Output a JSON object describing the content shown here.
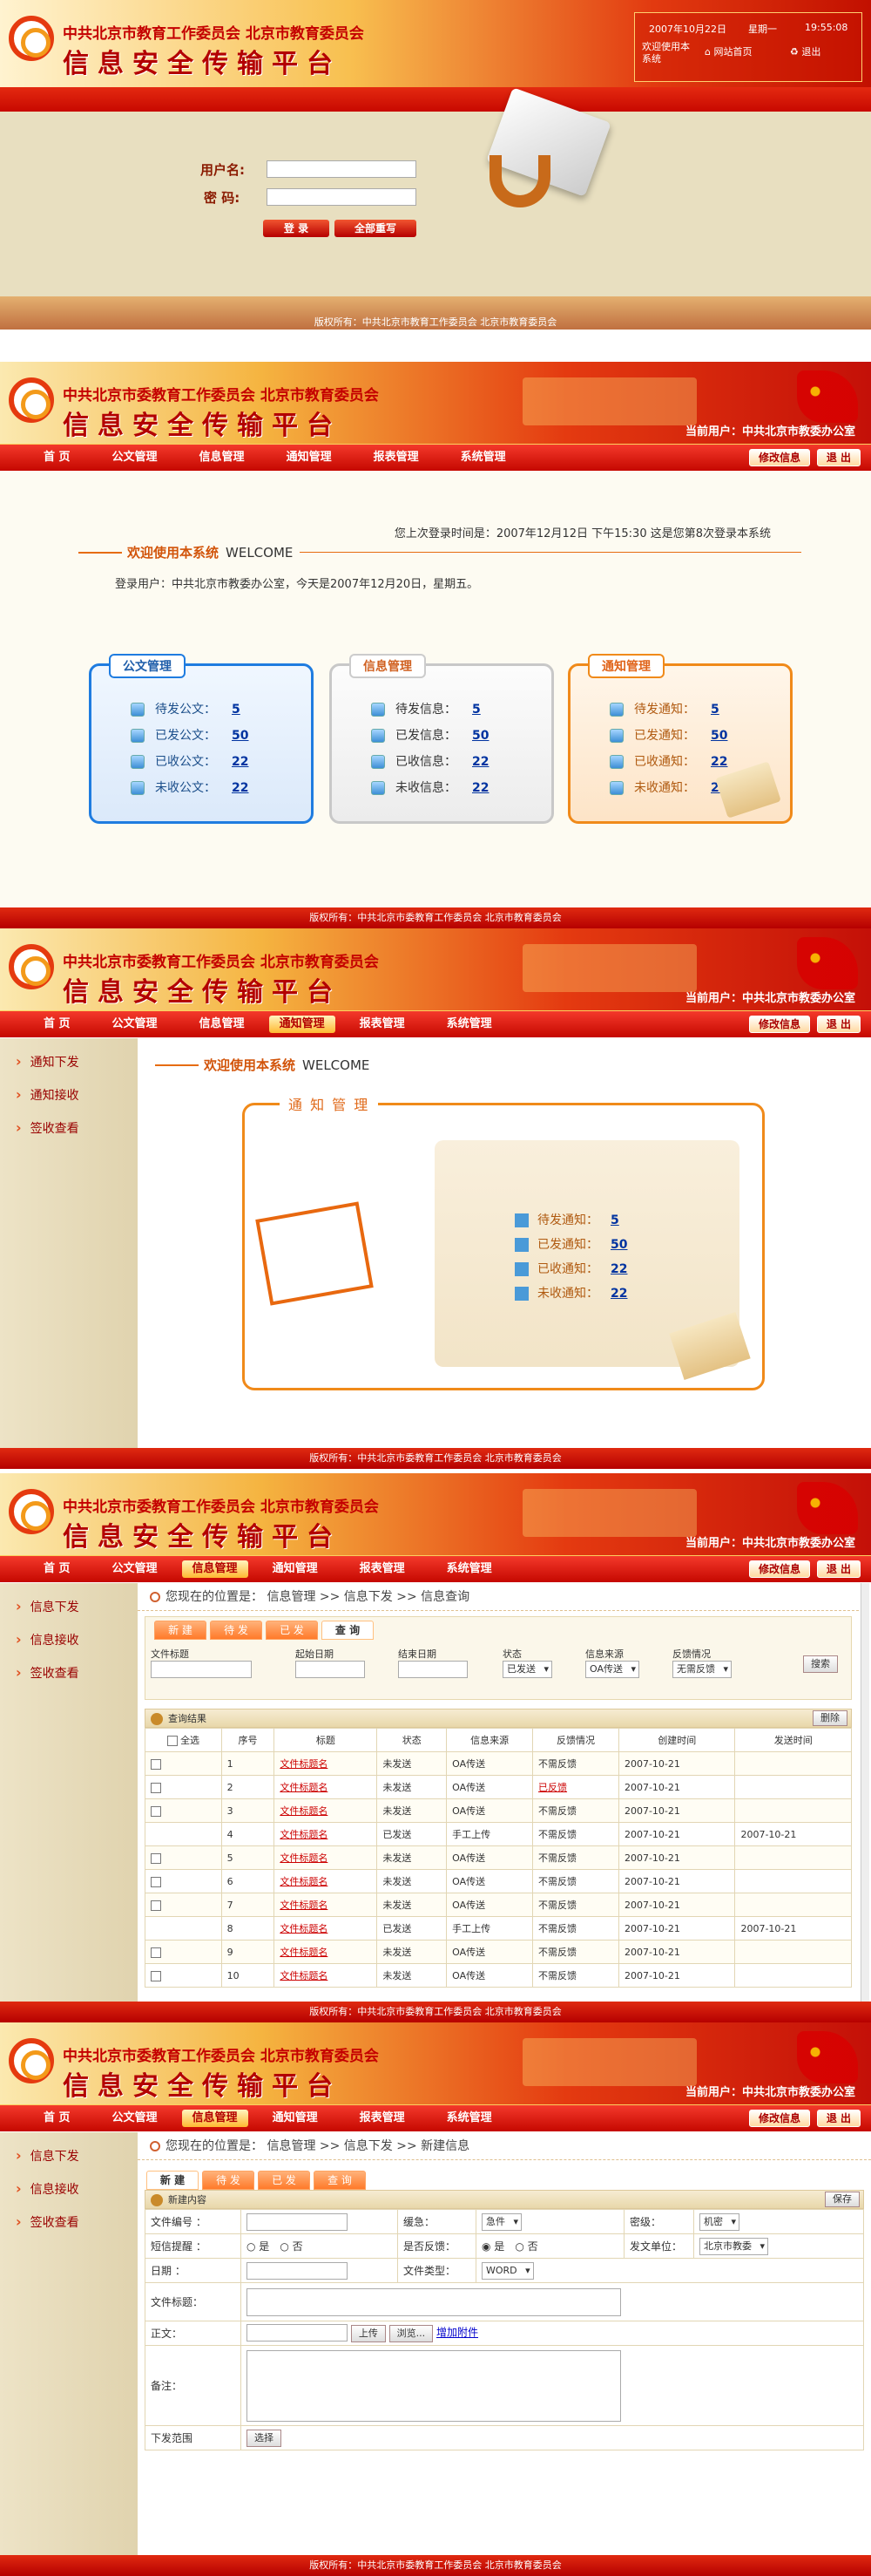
{
  "login": {
    "org": "中共北京市教育工作委员会 北京市教育委员会",
    "sys": "信息安全传输平台",
    "date": "2007年10月22日",
    "weekday": "星期一",
    "time": "19:55:08",
    "welcome_link": "欢迎使用本系统",
    "home_link": "网站首页",
    "exit_link": "退出",
    "user_label": "用户名:",
    "pass_label": "密 码:",
    "login_btn": "登 录",
    "reset_btn": "全部重写",
    "copyright": "版权所有：中共北京市教育工作委员会 北京市教育委员会"
  },
  "header": {
    "org": "中共北京市委教育工作委员会 北京市教育委员会",
    "sys": "信息安全传输平台",
    "current_user": "当前用户：中共北京市教委办公室",
    "nav": [
      "首 页",
      "公文管理",
      "信息管理",
      "通知管理",
      "报表管理",
      "系统管理"
    ],
    "edit_btn": "修改信息",
    "exit_btn": "退 出"
  },
  "home": {
    "last_login": "您上次登录时间是：2007年12月12日 下午15:30 这是您第8次登录本系统",
    "welcome_title": "欢迎使用本系统",
    "welcome_en": "WELCOME",
    "login_user": "登录用户：中共北京市教委办公室，今天是2007年12月20日，星期五。",
    "cards": [
      {
        "title": "公文管理",
        "rows": [
          {
            "label": "待发公文：",
            "value": "5"
          },
          {
            "label": "已发公文：",
            "value": "50"
          },
          {
            "label": "已收公文：",
            "value": "22"
          },
          {
            "label": "未收公文：",
            "value": "22"
          }
        ]
      },
      {
        "title": "信息管理",
        "rows": [
          {
            "label": "待发信息：",
            "value": "5"
          },
          {
            "label": "已发信息：",
            "value": "50"
          },
          {
            "label": "已收信息：",
            "value": "22"
          },
          {
            "label": "未收信息：",
            "value": "22"
          }
        ]
      },
      {
        "title": "通知管理",
        "rows": [
          {
            "label": "待发通知：",
            "value": "5"
          },
          {
            "label": "已发通知：",
            "value": "50"
          },
          {
            "label": "已收通知：",
            "value": "22"
          },
          {
            "label": "未收通知：",
            "value": "22"
          }
        ]
      }
    ],
    "copyright": "版权所有：中共北京市委教育工作委员会 北京市教育委员会"
  },
  "notice": {
    "side": [
      "通知下发",
      "通知接收",
      "签收查看"
    ],
    "welcome_title": "欢迎使用本系统",
    "welcome_en": "WELCOME",
    "box_title": "通 知 管 理",
    "rows": [
      {
        "label": "待发通知：",
        "value": "5"
      },
      {
        "label": "已发通知：",
        "value": "50"
      },
      {
        "label": "已收通知：",
        "value": "22"
      },
      {
        "label": "未收通知：",
        "value": "22"
      }
    ],
    "copyright": "版权所有：中共北京市委教育工作委员会 北京市教育委员会"
  },
  "query": {
    "side": [
      "信息下发",
      "信息接收",
      "签收查看"
    ],
    "breadcrumb": "您现在的位置是： 信息管理 >> 信息下发 >> 信息查询",
    "tabs": [
      "新 建",
      "待 发",
      "已 发",
      "查 询"
    ],
    "labels": [
      "文件标题",
      "起始日期",
      "结束日期",
      "状态",
      "信息来源",
      "反馈情况"
    ],
    "status_sel": "已发送",
    "source_sel": "OA传送",
    "feedback_sel": "无需反馈",
    "search_btn": "搜索",
    "result_title": "查询结果",
    "delete_btn": "删除",
    "cols": [
      "全选",
      "序号",
      "标题",
      "状态",
      "信息来源",
      "反馈情况",
      "创建时间",
      "发送时间"
    ],
    "rows": [
      [
        "1",
        "文件标题名",
        "未发送",
        "OA传送",
        "不需反馈",
        "2007-10-21",
        ""
      ],
      [
        "2",
        "文件标题名",
        "未发送",
        "OA传送",
        "已反馈",
        "2007-10-21",
        ""
      ],
      [
        "3",
        "文件标题名",
        "未发送",
        "OA传送",
        "不需反馈",
        "2007-10-21",
        ""
      ],
      [
        "4",
        "文件标题名",
        "已发送",
        "手工上传",
        "不需反馈",
        "2007-10-21",
        "2007-10-21"
      ],
      [
        "5",
        "文件标题名",
        "未发送",
        "OA传送",
        "不需反馈",
        "2007-10-21",
        ""
      ],
      [
        "6",
        "文件标题名",
        "未发送",
        "OA传送",
        "不需反馈",
        "2007-10-21",
        ""
      ],
      [
        "7",
        "文件标题名",
        "未发送",
        "OA传送",
        "不需反馈",
        "2007-10-21",
        ""
      ],
      [
        "8",
        "文件标题名",
        "已发送",
        "手工上传",
        "不需反馈",
        "2007-10-21",
        "2007-10-21"
      ],
      [
        "9",
        "文件标题名",
        "未发送",
        "OA传送",
        "不需反馈",
        "2007-10-21",
        ""
      ],
      [
        "10",
        "文件标题名",
        "未发送",
        "OA传送",
        "不需反馈",
        "2007-10-21",
        ""
      ]
    ],
    "copyright": "版权所有：中共北京市委教育工作委员会 北京市教育委员会"
  },
  "create": {
    "side": [
      "信息下发",
      "信息接收",
      "签收查看"
    ],
    "breadcrumb": "您现在的位置是： 信息管理 >> 信息下发 >> 新建信息",
    "tabs": [
      "新 建",
      "待 发",
      "已 发",
      "查 询"
    ],
    "section": "新建内容",
    "save_btn": "保存",
    "f_no": "文件编号 ：",
    "f_level": "缓急：",
    "f_level_val": "急件",
    "f_secret": "密级：",
    "f_secret_val": "机密",
    "f_sms": "短信提醒 ：",
    "yes": "是",
    "no": "否",
    "f_feedback": "是否反馈：",
    "f_unit": "发文单位：",
    "f_unit_val": "北京市教委",
    "f_date": "日期 ：",
    "f_type": "文件类型：",
    "f_type_val": "WORD",
    "f_title": "文件标题：",
    "f_body": "正文：",
    "upload_btn": "上传",
    "browse_btn": "浏览...",
    "add_attach": "增加附件",
    "f_remark": "备注：",
    "f_scope": "下发范围",
    "choose_btn": "选择",
    "copyright": "版权所有：中共北京市委教育工作委员会 北京市教育委员会"
  }
}
